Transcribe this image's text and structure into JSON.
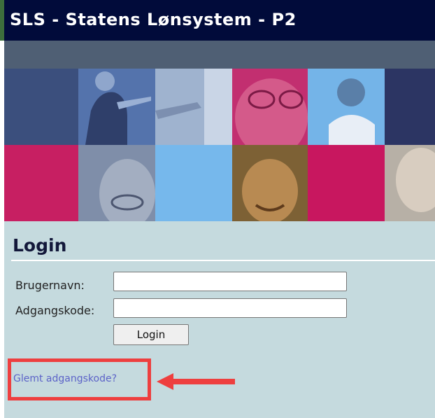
{
  "app": {
    "title": "SLS - Statens Lønsystem - P2"
  },
  "login": {
    "heading": "Login",
    "username_label": "Brugernavn:",
    "username_value": "",
    "password_label": "Adgangskode:",
    "password_value": "",
    "submit_label": "Login",
    "forgot_link": "Glemt adgangskode?"
  },
  "colors": {
    "titlebar": "#010b3a",
    "gray_bar": "#4f5f74",
    "panel": "#c5dade",
    "highlight": "#ee3f3f",
    "link": "#5c63c8"
  },
  "icons": {
    "annotation": "arrow-left-icon"
  }
}
